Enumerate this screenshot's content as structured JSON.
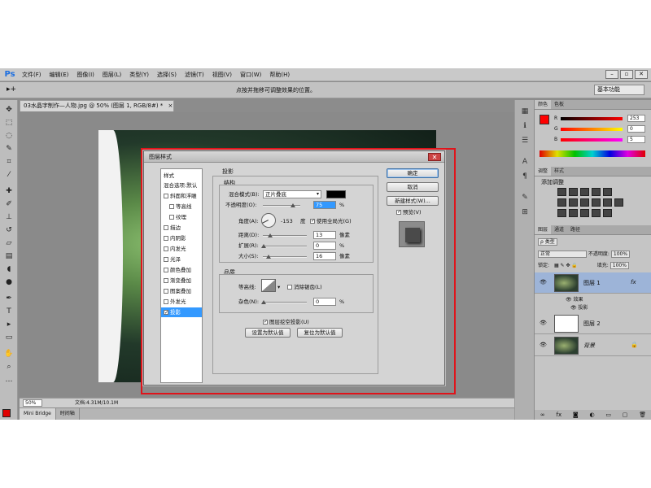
{
  "app": {
    "logo": "Ps"
  },
  "menu": [
    "文件(F)",
    "编辑(E)",
    "图像(I)",
    "图层(L)",
    "类型(Y)",
    "选择(S)",
    "滤镜(T)",
    "视图(V)",
    "窗口(W)",
    "帮助(H)"
  ],
  "window_controls": [
    "–",
    "▫",
    "✕"
  ],
  "options_bar": {
    "tool_glyph": "▸+",
    "hint": "点按并拖移可调整效果的位置。",
    "workspace": "基本功能"
  },
  "document": {
    "tab_title": "03水晶字制作—人物.jpg @ 50% (图层 1, RGB/8#) *",
    "tab_close": "×",
    "zoom": "50%",
    "info": "文档:4.31M/10.1M",
    "bottom_tabs": [
      "Mini Bridge",
      "时间轴"
    ]
  },
  "colors": {
    "accent": "#3399ff",
    "red_highlight": "#e0141b",
    "foreground": "#ff0000",
    "background": "#ffffff"
  },
  "color_panel": {
    "tabs": [
      "颜色",
      "色板"
    ],
    "rows": [
      {
        "letter": "R",
        "value": "253"
      },
      {
        "letter": "G",
        "value": "0"
      },
      {
        "letter": "B",
        "value": "5"
      }
    ]
  },
  "adjust_panel": {
    "tabs": [
      "调整",
      "样式"
    ],
    "title": "添加调整"
  },
  "layers_panel": {
    "tabs": [
      "图层",
      "通道",
      "路径"
    ],
    "kind_label": "ρ 类型",
    "blend_mode": "正常",
    "opacity_label": "不透明度:",
    "opacity_value": "100%",
    "lock_label": "锁定:",
    "fill_label": "填充:",
    "fill_value": "100%",
    "layers": [
      {
        "name": "图层 1",
        "fx": "fx",
        "effects_label": "效果",
        "effect": "投影"
      },
      {
        "name": "图层 2"
      },
      {
        "name": "背景",
        "lock": "🔒"
      }
    ],
    "footer_icons": [
      "∞",
      "fx",
      "◙",
      "◐",
      "▭",
      "▢",
      "🗑"
    ]
  },
  "dialog": {
    "title": "图层样式",
    "close": "✕",
    "styles_header": "样式",
    "blend_options": "混合选项:默认",
    "style_items": [
      {
        "label": "斜面和浮雕",
        "checked": false
      },
      {
        "label": "等高线",
        "checked": false,
        "indent": true
      },
      {
        "label": "纹理",
        "checked": false,
        "indent": true
      },
      {
        "label": "描边",
        "checked": false
      },
      {
        "label": "内阴影",
        "checked": false
      },
      {
        "label": "内发光",
        "checked": false
      },
      {
        "label": "光泽",
        "checked": false
      },
      {
        "label": "颜色叠加",
        "checked": false
      },
      {
        "label": "渐变叠加",
        "checked": false
      },
      {
        "label": "图案叠加",
        "checked": false
      },
      {
        "label": "外发光",
        "checked": false
      },
      {
        "label": "投影",
        "checked": true,
        "selected": true
      }
    ],
    "section_title": "投影",
    "structure": {
      "title": "结构",
      "blend_mode_label": "混合模式(B):",
      "blend_mode_value": "正片叠底",
      "shadow_color": "#000000",
      "opacity_label": "不透明度(O):",
      "opacity_value": "75",
      "opacity_unit": "%",
      "angle_label": "角度(A):",
      "angle_value": "-153",
      "angle_unit": "度",
      "global_light_label": "使用全局光(G)",
      "global_light": true,
      "distance_label": "距离(D):",
      "distance_value": "13",
      "distance_unit": "像素",
      "spread_label": "扩展(R):",
      "spread_value": "0",
      "spread_unit": "%",
      "size_label": "大小(S):",
      "size_value": "16",
      "size_unit": "像素"
    },
    "quality": {
      "title": "品质",
      "contour_label": "等高线:",
      "antialias_label": "消除锯齿(L)",
      "antialias": false,
      "noise_label": "杂色(N):",
      "noise_value": "0",
      "noise_unit": "%"
    },
    "knockout_label": "图层挖空投影(U)",
    "knockout": true,
    "make_default": "设置为默认值",
    "reset_default": "复位为默认值",
    "ok": "确定",
    "cancel": "取消",
    "new_style": "新建样式(W)...",
    "preview_label": "预览(V)",
    "preview": true
  }
}
